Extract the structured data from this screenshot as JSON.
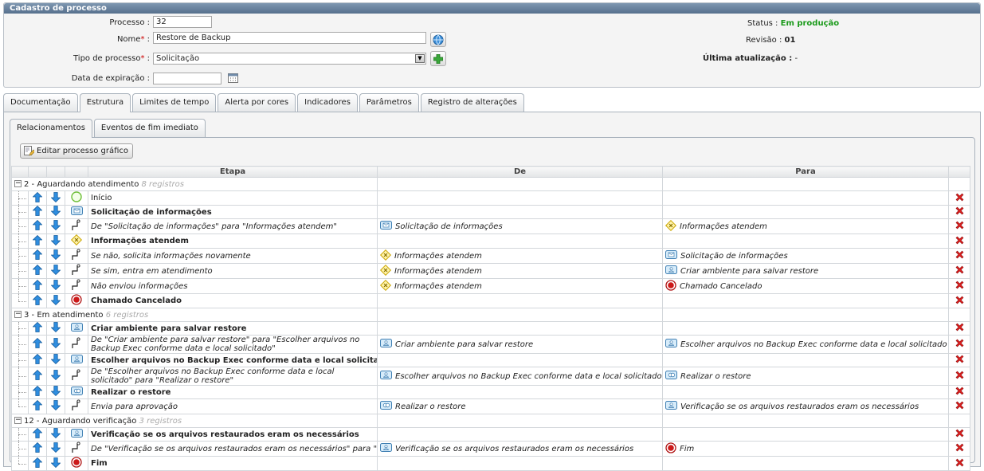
{
  "panel": {
    "title": "Cadastro de processo"
  },
  "form": {
    "processo_label": "Processo :",
    "processo_value": "32",
    "nome_label": "Nome",
    "nome_value": "Restore de Backup",
    "tipo_label": "Tipo de processo",
    "tipo_value": "Solicitação",
    "data_label": "Data de expiração :",
    "data_value": "",
    "colon": " :"
  },
  "status": {
    "status_label": "Status :",
    "status_value": "Em produção",
    "status_color": "#1a9a1a",
    "revisao_label": "Revisão :",
    "revisao_value": "01",
    "ultima_label": "Última atualização :",
    "ultima_value": "-"
  },
  "tabs": [
    "Documentação",
    "Estrutura",
    "Limites de tempo",
    "Alerta por cores",
    "Indicadores",
    "Parâmetros",
    "Registro de alterações"
  ],
  "subtabs": [
    "Relacionamentos",
    "Eventos de fim imediato"
  ],
  "edit_button": "Editar processo gráfico",
  "columns": {
    "etapa": "Etapa",
    "de": "De",
    "para": "Para"
  },
  "groups": [
    {
      "label": "2 - Aguardando atendimento",
      "count": "8 registros",
      "rows": [
        {
          "type": "start",
          "text": "Início",
          "style": "n",
          "de": "",
          "de_icon": "",
          "para": "",
          "para_icon": ""
        },
        {
          "type": "task-envelope",
          "text": "Solicitação de informações",
          "style": "b",
          "de": "",
          "de_icon": "",
          "para": "",
          "para_icon": ""
        },
        {
          "type": "flow",
          "text": "De \"Solicitação de informações\" para \"Informações atendem\"",
          "style": "i",
          "de": "Solicitação de informações",
          "de_icon": "task-envelope",
          "para": "Informações atendem",
          "para_icon": "gateway"
        },
        {
          "type": "gateway",
          "text": "Informações atendem",
          "style": "b",
          "de": "",
          "de_icon": "",
          "para": "",
          "para_icon": ""
        },
        {
          "type": "flow",
          "text": "Se não, solicita informações novamente",
          "style": "i",
          "de": "Informações atendem",
          "de_icon": "gateway",
          "para": "Solicitação de informações",
          "para_icon": "task-envelope"
        },
        {
          "type": "flow",
          "text": "Se sim, entra em atendimento",
          "style": "i",
          "de": "Informações atendem",
          "de_icon": "gateway",
          "para": "Criar ambiente para salvar restore",
          "para_icon": "task-user"
        },
        {
          "type": "flow",
          "text": "Não enviou informações",
          "style": "i",
          "de": "Informações atendem",
          "de_icon": "gateway",
          "para": "Chamado Cancelado",
          "para_icon": "end"
        },
        {
          "type": "end",
          "text": "Chamado Cancelado",
          "style": "b",
          "de": "",
          "de_icon": "",
          "para": "",
          "para_icon": ""
        }
      ]
    },
    {
      "label": "3 - Em atendimento",
      "count": "6 registros",
      "rows": [
        {
          "type": "task-user",
          "text": "Criar ambiente para salvar restore",
          "style": "b",
          "de": "",
          "de_icon": "",
          "para": "",
          "para_icon": ""
        },
        {
          "type": "flow",
          "text": "De \"Criar ambiente para salvar restore\" para \"Escolher arquivos no Backup Exec conforme data e local solicitado\"",
          "style": "i",
          "tall": true,
          "de": "Criar ambiente para salvar restore",
          "de_icon": "task-user",
          "para": "Escolher arquivos no Backup Exec conforme data e local solicitado",
          "para_icon": "task-user"
        },
        {
          "type": "task-user",
          "text": "Escolher arquivos no Backup Exec conforme data e local solicitado",
          "style": "b",
          "de": "",
          "de_icon": "",
          "para": "",
          "para_icon": ""
        },
        {
          "type": "flow",
          "text": "De \"Escolher arquivos no Backup Exec conforme data e local solicitado\" para \"Realizar o restore\"",
          "style": "i",
          "tall": true,
          "de": "Escolher arquivos no Backup Exec conforme data e local solicitado",
          "de_icon": "task-user",
          "para": "Realizar o restore",
          "para_icon": "task-gear"
        },
        {
          "type": "task-gear",
          "text": "Realizar o restore",
          "style": "b",
          "de": "",
          "de_icon": "",
          "para": "",
          "para_icon": ""
        },
        {
          "type": "flow",
          "text": "Envia para aprovação",
          "style": "i",
          "de": "Realizar o restore",
          "de_icon": "task-gear",
          "para": "Verificação se os arquivos restaurados eram os necessários",
          "para_icon": "task-user"
        }
      ]
    },
    {
      "label": "12 - Aguardando verificação",
      "count": "3 registros",
      "rows": [
        {
          "type": "task-user",
          "text": "Verificação se os arquivos restaurados eram os necessários",
          "style": "b",
          "de": "",
          "de_icon": "",
          "para": "",
          "para_icon": ""
        },
        {
          "type": "flow",
          "text": "De \"Verificação se os arquivos restaurados eram os necessários\" para \"Fim\"",
          "style": "i",
          "de": "Verificação se os arquivos restaurados eram os necessários",
          "de_icon": "task-user",
          "para": "Fim",
          "para_icon": "end"
        },
        {
          "type": "end",
          "text": "Fim",
          "style": "b",
          "de": "",
          "de_icon": "",
          "para": "",
          "para_icon": ""
        }
      ]
    }
  ]
}
